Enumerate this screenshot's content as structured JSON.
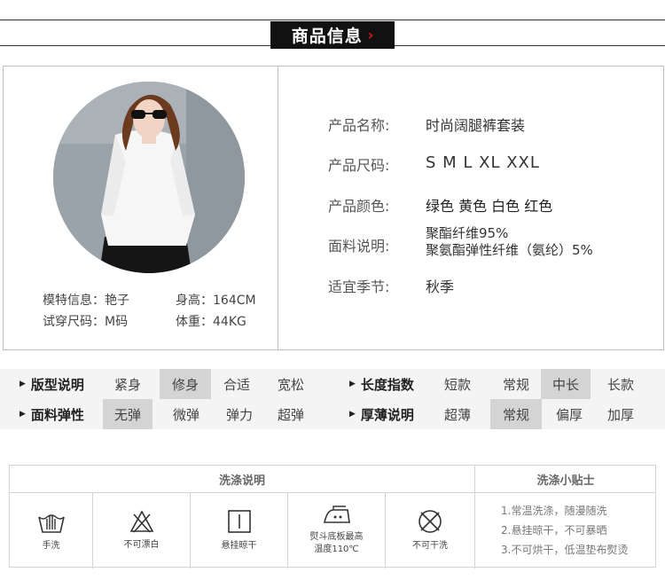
{
  "header": {
    "title": "商品信息",
    "chevron": "›"
  },
  "model": {
    "name_label": "模特信息：",
    "name_value": "艳子",
    "height_label": "身高：",
    "height_value": "164CM",
    "size_label": "试穿尺码：",
    "size_value": "M码",
    "weight_label": "体重：",
    "weight_value": "44KG"
  },
  "product": {
    "name_label": "产品名称:",
    "name_value": "时尚阔腿裤套装",
    "size_label": "产品尺码:",
    "size_value": "S M L XL XXL",
    "color_label": "产品颜色:",
    "color_value": "绿色 黄色 白色 红色",
    "fabric_label": "面料说明:",
    "fabric_value_1": "聚酯纤维95%",
    "fabric_value_2": "聚氨酯弹性纤维（氨纶）5%",
    "season_label": "适宜季节:",
    "season_value": "秋季"
  },
  "attributes": {
    "fit": {
      "title": "版型说明",
      "options": [
        "紧身",
        "修身",
        "合适",
        "宽松"
      ],
      "selected": "修身"
    },
    "length": {
      "title": "长度指数",
      "options": [
        "短款",
        "常规",
        "中长",
        "长款"
      ],
      "selected": "中长"
    },
    "elasticity": {
      "title": "面料弹性",
      "options": [
        "无弹",
        "微弹",
        "弹力",
        "超弹"
      ],
      "selected": "无弹"
    },
    "thickness": {
      "title": "厚薄说明",
      "options": [
        "超薄",
        "常规",
        "偏厚",
        "加厚"
      ],
      "selected": "常规"
    }
  },
  "washing": {
    "header_left": "洗涤说明",
    "header_right": "洗涤小贴士",
    "icons": [
      {
        "name": "hand-wash-icon",
        "label": "手洗"
      },
      {
        "name": "no-bleach-icon",
        "label": "不可漂白"
      },
      {
        "name": "hang-dry-icon",
        "label": "悬挂晾干"
      },
      {
        "name": "iron-icon",
        "label": "熨斗底板最高\n温度110℃"
      },
      {
        "name": "no-dry-clean-icon",
        "label": "不可干洗"
      }
    ],
    "tips": [
      "1.常温洗涤，随漫随洗",
      "2.悬挂晾干，不可暴晒",
      "3.不可烘干，低温垫布熨烫"
    ]
  },
  "colors": {
    "selected_bg": "#d4d4d4",
    "row_bg": "#f4f4f4",
    "accent": "#e0161c"
  }
}
